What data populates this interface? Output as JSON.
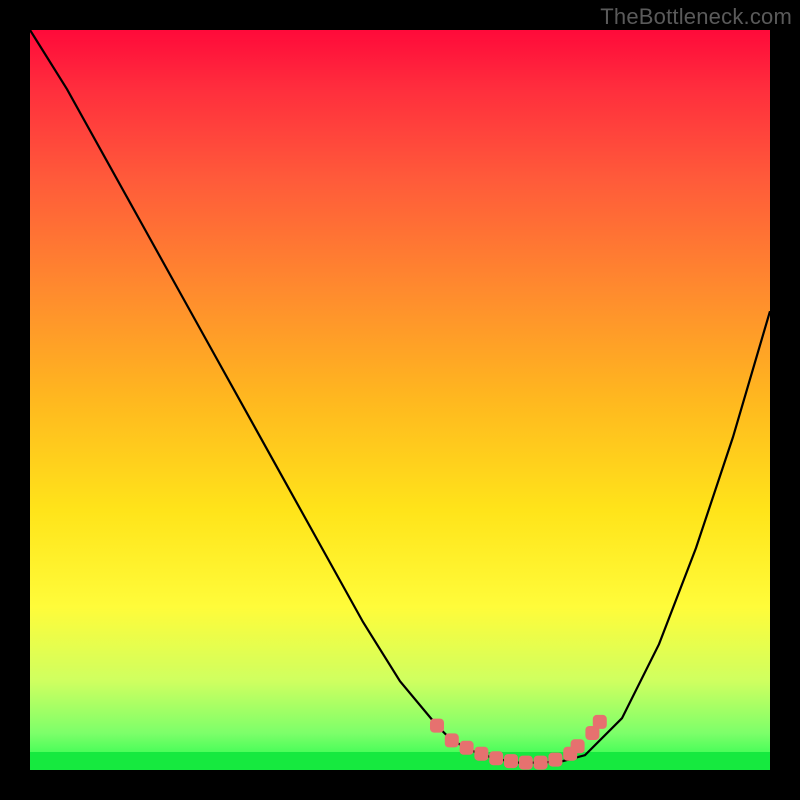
{
  "watermark": "TheBottleneck.com",
  "colors": {
    "frame": "#000000",
    "curve_stroke": "#000000",
    "marker_fill": "#e6716f",
    "green_band": "#16e93f"
  },
  "chart_data": {
    "type": "line",
    "title": "",
    "xlabel": "",
    "ylabel": "",
    "xlim": [
      0,
      100
    ],
    "ylim": [
      0,
      100
    ],
    "grid": false,
    "legend": false,
    "series": [
      {
        "name": "bottleneck-curve",
        "x": [
          0,
          5,
          10,
          15,
          20,
          25,
          30,
          35,
          40,
          45,
          50,
          55,
          57,
          60,
          63,
          66,
          69,
          72,
          75,
          80,
          85,
          90,
          95,
          100
        ],
        "y": [
          100,
          92,
          83,
          74,
          65,
          56,
          47,
          38,
          29,
          20,
          12,
          6,
          4,
          2.5,
          1.5,
          1,
          1,
          1.2,
          2,
          7,
          17,
          30,
          45,
          62
        ]
      }
    ],
    "markers": {
      "name": "optimal-range",
      "x": [
        55,
        57,
        59,
        61,
        63,
        65,
        67,
        69,
        71,
        73,
        74,
        76,
        77
      ],
      "y": [
        6,
        4,
        3,
        2.2,
        1.6,
        1.2,
        1.0,
        1.0,
        1.4,
        2.2,
        3.2,
        5.0,
        6.5
      ]
    }
  }
}
